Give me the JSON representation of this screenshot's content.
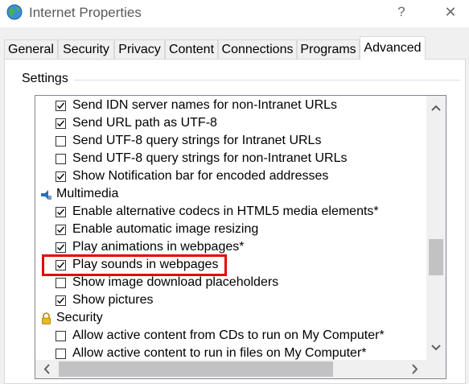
{
  "window": {
    "title": "Internet Properties",
    "help_label": "?",
    "close_label": "✕"
  },
  "tabs": [
    {
      "label": "General"
    },
    {
      "label": "Security"
    },
    {
      "label": "Privacy"
    },
    {
      "label": "Content"
    },
    {
      "label": "Connections"
    },
    {
      "label": "Programs"
    },
    {
      "label": "Advanced",
      "active": true
    }
  ],
  "settings": {
    "group_label": "Settings",
    "rows": [
      {
        "type": "checkbox",
        "label": "Send IDN server names for non-Intranet URLs",
        "checked": true
      },
      {
        "type": "checkbox",
        "label": "Send URL path as UTF-8",
        "checked": true
      },
      {
        "type": "checkbox",
        "label": "Send UTF-8 query strings for Intranet URLs",
        "checked": false
      },
      {
        "type": "checkbox",
        "label": "Send UTF-8 query strings for non-Intranet URLs",
        "checked": false
      },
      {
        "type": "checkbox",
        "label": "Show Notification bar for encoded addresses",
        "checked": true
      },
      {
        "type": "category",
        "label": "Multimedia",
        "icon": "multimedia-icon"
      },
      {
        "type": "checkbox",
        "label": "Enable alternative codecs in HTML5 media elements*",
        "checked": true
      },
      {
        "type": "checkbox",
        "label": "Enable automatic image resizing",
        "checked": true
      },
      {
        "type": "checkbox",
        "label": "Play animations in webpages*",
        "checked": true
      },
      {
        "type": "checkbox",
        "label": "Play sounds in webpages",
        "checked": true,
        "highlighted": true
      },
      {
        "type": "checkbox",
        "label": "Show image download placeholders",
        "checked": false
      },
      {
        "type": "checkbox",
        "label": "Show pictures",
        "checked": true
      },
      {
        "type": "category",
        "label": "Security",
        "icon": "lock-icon"
      },
      {
        "type": "checkbox",
        "label": "Allow active content from CDs to run on My Computer*",
        "checked": false
      },
      {
        "type": "checkbox",
        "label": "Allow active content to run in files on My Computer*",
        "checked": false
      }
    ]
  },
  "colors": {
    "highlight": "#e60000",
    "accent": "#0078d7"
  }
}
